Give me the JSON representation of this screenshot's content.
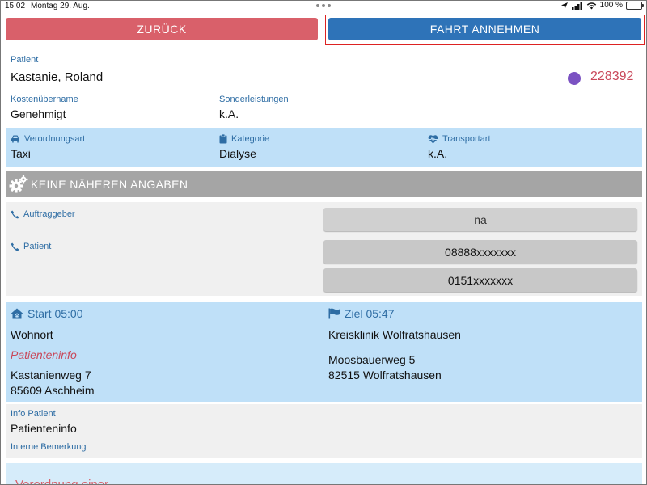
{
  "status_bar": {
    "time": "15:02",
    "date": "Montag 29. Aug.",
    "battery": "100 %",
    "battery_level": 1.0
  },
  "toolbar": {
    "back_label": "ZURÜCK",
    "accept_label": "FAHRT ANNEHMEN"
  },
  "patient": {
    "label": "Patient",
    "name": "Kastanie, Roland",
    "id": "228392",
    "status_color": "#7b52c2"
  },
  "billing": {
    "cost_label": "Kostenübername",
    "cost_value": "Genehmigt",
    "extra_label": "Sonderleistungen",
    "extra_value": "k.A."
  },
  "order": {
    "prescription_label": "Verordnungsart",
    "prescription_value": "Taxi",
    "category_label": "Kategorie",
    "category_value": "Dialyse",
    "transport_label": "Transportart",
    "transport_value": "k.A."
  },
  "notes_header": "KEINE NÄHEREN ANGABEN",
  "contacts": {
    "client_label": "Auftraggeber",
    "client_phone": "na",
    "patient_label": "Patient",
    "patient_phone_1": "08888xxxxxxx",
    "patient_phone_2": "0151xxxxxxx"
  },
  "route": {
    "start_label": "Start 05:00",
    "start_place": "Wohnort",
    "start_info": "Patienteninfo",
    "start_street": "Kastanienweg 7",
    "start_city": "85609 Aschheim",
    "end_label": "Ziel 05:47",
    "end_place": "Kreisklinik Wolfratshausen",
    "end_street": "Moosbauerweg 5",
    "end_city": "82515 Wolfratshausen"
  },
  "info": {
    "info_label": "Info Patient",
    "info_value": "Patienteninfo",
    "internal_label": "Interne Bemerkung"
  },
  "footer_text": "Verordnung einer",
  "colors": {
    "accent": "#2e73b8",
    "danger": "#d9606a",
    "label": "#2e6da4",
    "band_blue": "#bfe0f8",
    "band_gray": "#f0f0f0"
  }
}
